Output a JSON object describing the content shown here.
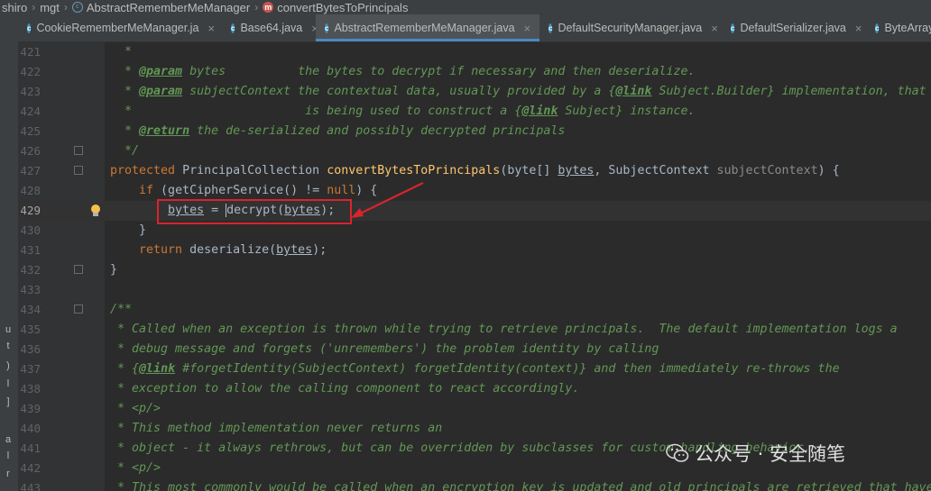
{
  "breadcrumb": [
    "shiro",
    "mgt",
    "AbstractRememberMeManager",
    "convertBytesToPrincipals"
  ],
  "tabs": [
    {
      "label": "CookieRememberMeManager.ja",
      "active": false
    },
    {
      "label": "Base64.java",
      "active": false
    },
    {
      "label": "AbstractRememberMeManager.java",
      "active": true
    },
    {
      "label": "DefaultSecurityManager.java",
      "active": false
    },
    {
      "label": "DefaultSerializer.java",
      "active": false
    },
    {
      "label": "ByteArrayIn",
      "active": false
    }
  ],
  "line_numbers": [
    "421",
    "422",
    "423",
    "424",
    "425",
    "426",
    "427",
    "428",
    "429",
    "430",
    "431",
    "432",
    "433",
    "434",
    "435",
    "436",
    "437",
    "438",
    "439",
    "440",
    "441",
    "442",
    "443"
  ],
  "current_line": "429",
  "code": {
    "l421": "*",
    "l422_tag": "@param",
    "l422_rest": " bytes          the bytes to decrypt if necessary and then deserialize.",
    "l423_tag": "@param",
    "l423_a": " subjectContext the contextual data, usually provided by a {",
    "l423_link": "@link",
    "l423_b": " Subject.Builder} implementation, that",
    "l424_a": "*                        is being used to construct a {",
    "l424_link": "@link",
    "l424_b": " Subject} instance.",
    "l425_tag": "@return",
    "l425_rest": " the de-serialized and possibly decrypted principals",
    "l426": "*/",
    "l427_kw": "protected",
    "l427_type": " PrincipalCollection ",
    "l427_fn": "convertBytesToPrincipals",
    "l427_p1": "(byte[] ",
    "l427_bytes": "bytes",
    "l427_p2": ", SubjectContext ",
    "l427_param": "subjectContext",
    "l427_p3": ") {",
    "l428_kw": "if",
    "l428_a": " (getCipherService() != ",
    "l428_null": "null",
    "l428_b": ") {",
    "l429_bytes": "bytes",
    "l429_eq": " = ",
    "l429_dec": "decrypt(",
    "l429_arg": "bytes",
    "l429_end": ");",
    "l430": "}",
    "l431_kw": "return",
    "l431_a": " deserialize(",
    "l431_arg": "bytes",
    "l431_b": ");",
    "l432": "}",
    "l434": "/**",
    "l435": "* Called when an exception is thrown while trying to retrieve principals.  The default implementation logs a",
    "l436": "* debug message and forgets ('unremembers') the problem identity by calling",
    "l437_a": "* {",
    "l437_link": "@link",
    "l437_b": " #forgetIdentity(SubjectContext) forgetIdentity(context)} and then immediately re-throws the",
    "l438": "* exception to allow the calling component to react accordingly.",
    "l439": "* <p/>",
    "l440": "* This method implementation never returns an",
    "l441": "* object - it always rethrows, but can be overridden by subclasses for custom handling behavior.",
    "l442": "* <p/>",
    "l443": "* This most commonly would be called when an encryption key is updated and old principals are retrieved that have"
  },
  "left_fragments": [
    "u",
    "t",
    ")",
    "l",
    "]",
    "a",
    "l",
    "r"
  ],
  "watermark": "公众号 · 安全随笔",
  "colors": {
    "highlight_box": "#d9232e",
    "arrow": "#d9232e",
    "active_tab_underline": "#4a88c7"
  }
}
